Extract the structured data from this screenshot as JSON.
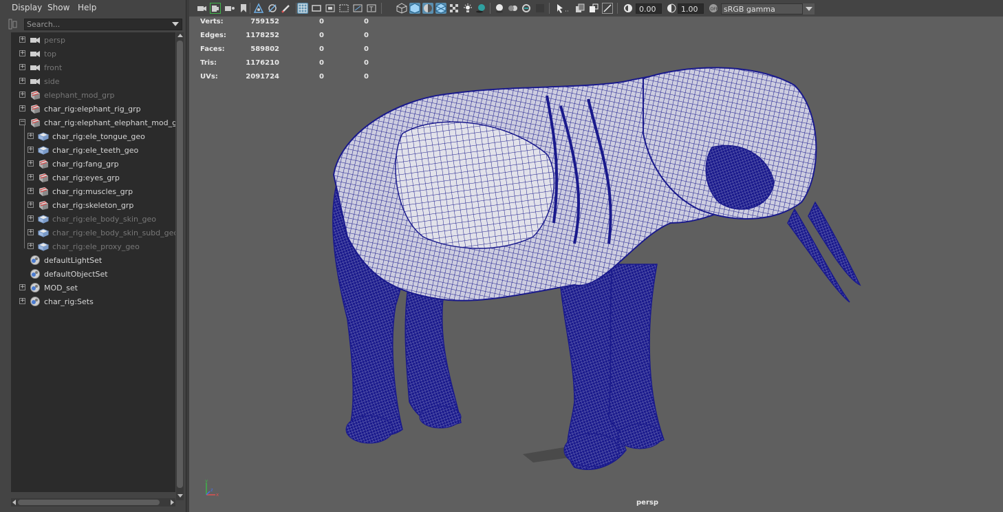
{
  "outliner": {
    "menu": [
      "Display",
      "Show",
      "Help"
    ],
    "search": {
      "placeholder": "Search..."
    },
    "items": [
      {
        "label": "persp",
        "type": "camera",
        "state": "dim"
      },
      {
        "label": "top",
        "type": "camera",
        "state": "dim"
      },
      {
        "label": "front",
        "type": "camera",
        "state": "dim"
      },
      {
        "label": "side",
        "type": "camera",
        "state": "dim"
      },
      {
        "label": "elephant_mod_grp",
        "type": "group",
        "state": "dim"
      },
      {
        "label": "char_rig:elephant_rig_grp",
        "type": "group",
        "state": "normal"
      },
      {
        "label": "char_rig:elephant_elephant_mod_grp",
        "type": "group",
        "state": "normal",
        "expanded": true
      },
      {
        "label": "char_rig:ele_tongue_geo",
        "type": "mesh",
        "state": "normal"
      },
      {
        "label": "char_rig:ele_teeth_geo",
        "type": "mesh",
        "state": "normal"
      },
      {
        "label": "char_rig:fang_grp",
        "type": "group",
        "state": "normal"
      },
      {
        "label": "char_rig:eyes_grp",
        "type": "group",
        "state": "normal"
      },
      {
        "label": "char_rig:muscles_grp",
        "type": "group",
        "state": "normal"
      },
      {
        "label": "char_rig:skeleton_grp",
        "type": "group",
        "state": "normal"
      },
      {
        "label": "char_rig:ele_body_skin_geo",
        "type": "mesh",
        "state": "dim"
      },
      {
        "label": "char_rig:ele_body_skin_subd_geo",
        "type": "mesh",
        "state": "dim"
      },
      {
        "label": "char_rig:ele_proxy_geo",
        "type": "mesh",
        "state": "dim"
      },
      {
        "label": "defaultLightSet",
        "type": "set",
        "state": "normal"
      },
      {
        "label": "defaultObjectSet",
        "type": "set",
        "state": "normal"
      },
      {
        "label": "MOD_set",
        "type": "set",
        "state": "normal"
      },
      {
        "label": "char_rig:Sets",
        "type": "set",
        "state": "normal"
      }
    ]
  },
  "viewport": {
    "exposure": "0.00",
    "gamma": "1.00",
    "color_space": "sRGB gamma",
    "camera": "persp",
    "hud": [
      {
        "label": "Verts:",
        "total": "759152",
        "selected": "0",
        "components": "0"
      },
      {
        "label": "Edges:",
        "total": "1178252",
        "selected": "0",
        "components": "0"
      },
      {
        "label": "Faces:",
        "total": "589802",
        "selected": "0",
        "components": "0"
      },
      {
        "label": "Tris:",
        "total": "1176210",
        "selected": "0",
        "components": "0"
      },
      {
        "label": "UVs:",
        "total": "2091724",
        "selected": "0",
        "components": "0"
      }
    ],
    "axis_labels": {
      "y": "y",
      "x": "x",
      "z": "z"
    },
    "colors": {
      "wireframe": "#1a1a8c",
      "background": "#5f5f5f",
      "shaded": "#c8c8c8"
    }
  }
}
